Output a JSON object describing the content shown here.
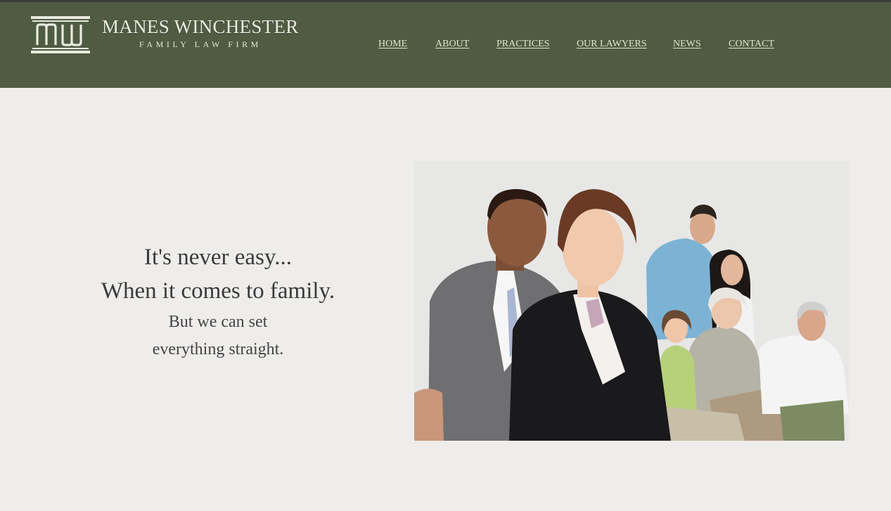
{
  "brand": {
    "name": "MANES WINCHESTER",
    "tagline": "FAMILY LAW FIRM",
    "logo_icon": "pillar-monogram-icon"
  },
  "nav": {
    "items": [
      {
        "label": "HOME"
      },
      {
        "label": "ABOUT"
      },
      {
        "label": "PRACTICES"
      },
      {
        "label": "OUR LAWYERS"
      },
      {
        "label": "NEWS"
      },
      {
        "label": "CONTACT"
      }
    ]
  },
  "hero": {
    "line1": "It's never easy...",
    "line2": "When it comes to family.",
    "line3": "But we can set",
    "line4": "everything straight."
  },
  "colors": {
    "header_bg": "#505b44",
    "page_bg": "#eeedeb",
    "nav_link": "#dfe6c7",
    "heading_text": "#3a3a3a"
  }
}
